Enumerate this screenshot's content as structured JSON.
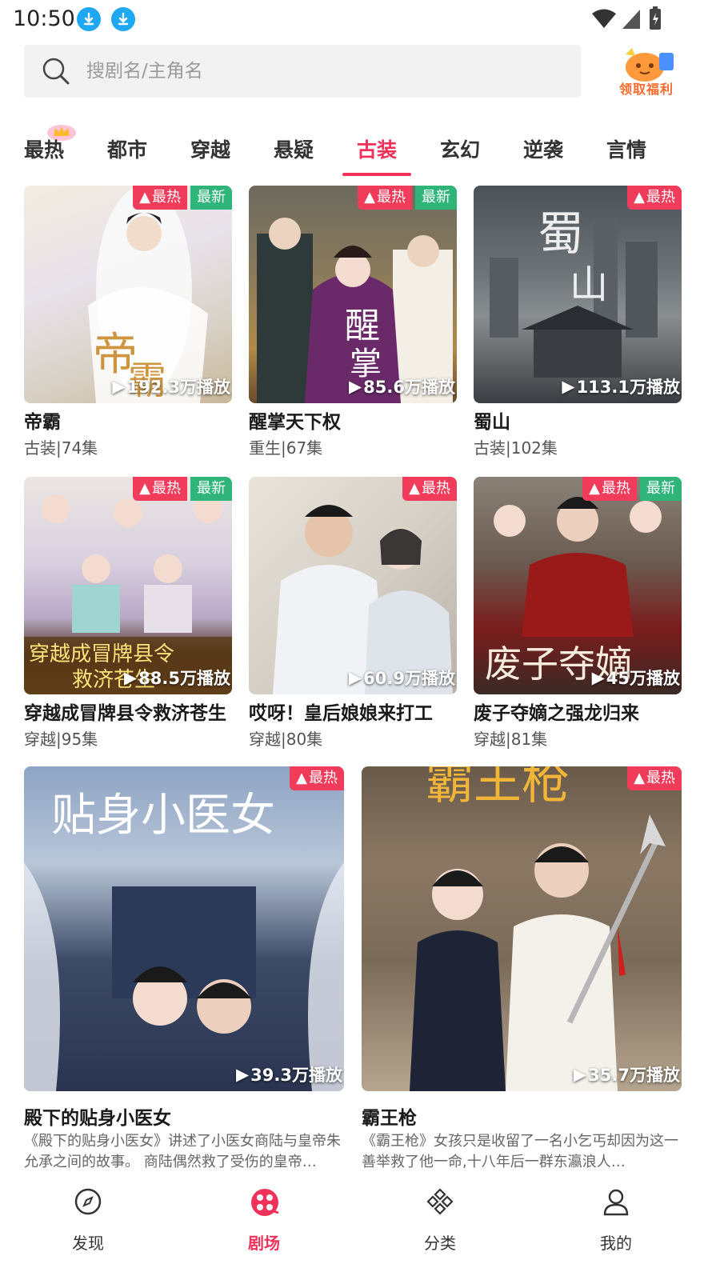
{
  "status_bar": {
    "time": "10:50"
  },
  "search": {
    "placeholder": "搜剧名/主角名"
  },
  "reward": {
    "label": "领取福利"
  },
  "tabs": [
    {
      "label": "最热"
    },
    {
      "label": "都市"
    },
    {
      "label": "穿越"
    },
    {
      "label": "悬疑"
    },
    {
      "label": "古装",
      "active": true
    },
    {
      "label": "玄幻"
    },
    {
      "label": "逆袭"
    },
    {
      "label": "言情"
    }
  ],
  "badges": {
    "hot": "最热",
    "new": "最新"
  },
  "dramas": [
    {
      "title": "帝霸",
      "meta": "古装|74集",
      "plays": "192.3万播放",
      "hot": true,
      "new": true
    },
    {
      "title": "醒掌天下权",
      "meta": "重生|67集",
      "plays": "85.6万播放",
      "hot": true,
      "new": true
    },
    {
      "title": "蜀山",
      "meta": "古装|102集",
      "plays": "113.1万播放",
      "hot": true,
      "new": false
    },
    {
      "title": "穿越成冒牌县令救济苍生",
      "meta": "穿越|95集",
      "plays": "88.5万播放",
      "hot": true,
      "new": true
    },
    {
      "title": "哎呀！皇后娘娘来打工",
      "meta": "穿越|80集",
      "plays": "60.9万播放",
      "hot": true,
      "new": false
    },
    {
      "title": "废子夺嫡之强龙归来",
      "meta": "穿越|81集",
      "plays": "45万播放",
      "hot": true,
      "new": true
    }
  ],
  "featured": [
    {
      "title": "殿下的贴身小医女",
      "poster_text": "贴身小医女",
      "plays": "39.3万播放",
      "desc": "《殿下的贴身小医女》讲述了小医女商陆与皇帝朱允承之间的故事。 商陆偶然救了受伤的皇帝…"
    },
    {
      "title": "霸王枪",
      "poster_text": "霸王枪",
      "plays": "35.7万播放",
      "desc": "《霸王枪》女孩只是收留了一名小乞丐却因为这一善举救了他一命,十八年后一群东瀛浪人…"
    }
  ],
  "bottom_nav": [
    {
      "label": "发现",
      "icon": "compass-icon"
    },
    {
      "label": "剧场",
      "icon": "theater-reel-icon",
      "active": true
    },
    {
      "label": "分类",
      "icon": "category-icon"
    },
    {
      "label": "我的",
      "icon": "profile-icon"
    }
  ],
  "colors": {
    "accent": "#f0315a",
    "hot": "#f03c5a",
    "new": "#2fb57a",
    "download": "#1ea7f2"
  }
}
